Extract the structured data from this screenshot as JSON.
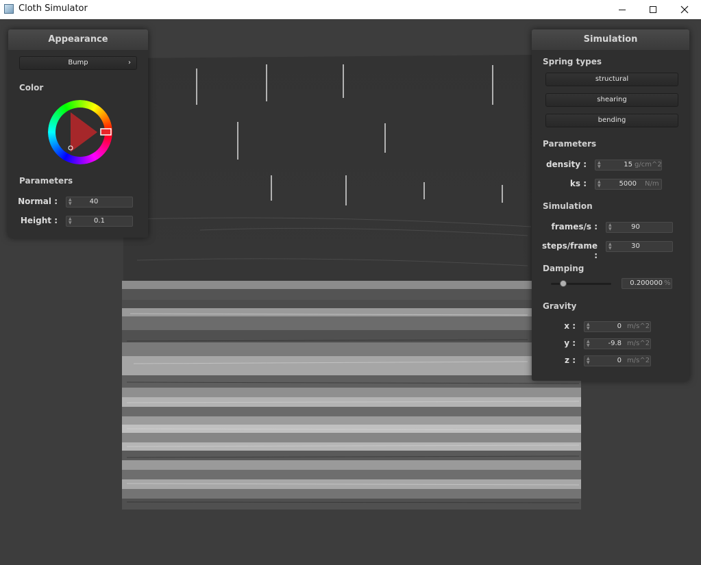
{
  "window": {
    "title": "Cloth Simulator",
    "controls": [
      "minimize-icon",
      "maximize-icon",
      "close-icon"
    ]
  },
  "appearance": {
    "title": "Appearance",
    "shader_dropdown": {
      "value": "Bump",
      "icon": "chevron-right-icon"
    },
    "color_label": "Color",
    "color_wheel_icon": "color-wheel-icon",
    "params_label": "Parameters",
    "normal": {
      "label": "Normal :",
      "value": "40"
    },
    "height": {
      "label": "Height :",
      "value": "0.1"
    }
  },
  "simulation": {
    "title": "Simulation",
    "spring_types_label": "Spring types",
    "spring_buttons": [
      "structural",
      "shearing",
      "bending"
    ],
    "parameters_label": "Parameters",
    "density": {
      "label": "density :",
      "value": "15",
      "unit": "g/cm^2"
    },
    "ks": {
      "label": "ks :",
      "value": "5000",
      "unit": "N/m"
    },
    "sim_label": "Simulation",
    "fps": {
      "label": "frames/s :",
      "value": "90"
    },
    "steps": {
      "label": "steps/frame :",
      "value": "30"
    },
    "damping_label": "Damping",
    "damping": {
      "value": "0.200000",
      "unit": "%",
      "slider_fraction": 0.2
    },
    "gravity_label": "Gravity",
    "gx": {
      "label": "x :",
      "value": "0",
      "unit": "m/s^2"
    },
    "gy": {
      "label": "y :",
      "value": "-9.8",
      "unit": "m/s^2"
    },
    "gz": {
      "label": "z :",
      "value": "0",
      "unit": "m/s^2"
    }
  },
  "colors": {
    "panel_bg": "#2f2f2f",
    "header_bg": "#3f3f3f",
    "viewport_bg": "#3d3d3d",
    "selected_color": "#e8262a"
  }
}
